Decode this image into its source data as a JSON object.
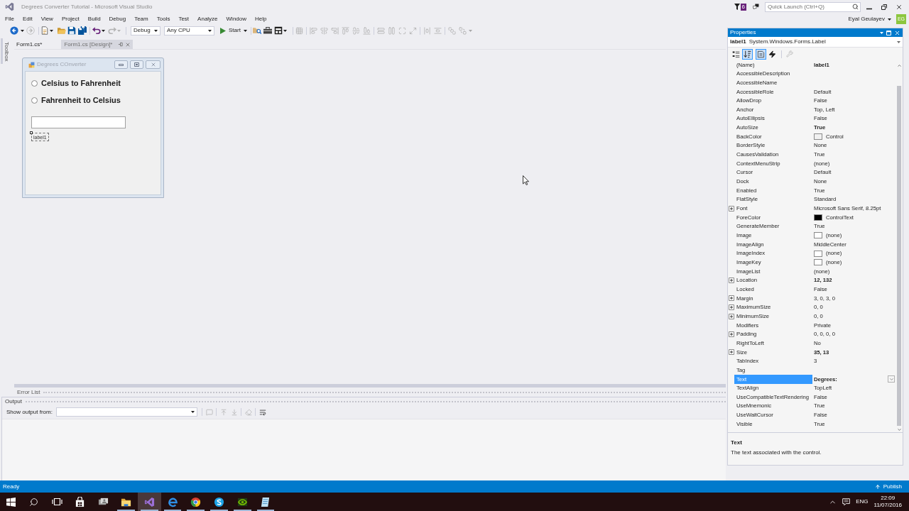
{
  "window": {
    "title": "Degrees Converter Tutorial - Microsoft Visual Studio",
    "notification_count": "6",
    "quick_launch": {
      "placeholder": "Quick Launch (Ctrl+Q)"
    }
  },
  "menu": [
    "File",
    "Edit",
    "View",
    "Project",
    "Build",
    "Debug",
    "Team",
    "Tools",
    "Test",
    "Analyze",
    "Window",
    "Help"
  ],
  "user": {
    "name": "Eyal Geulayev",
    "initials": "EG"
  },
  "toolbar": {
    "forward_disabled": true,
    "redo_disabled": true,
    "configuration": "Debug",
    "platform": "Any CPU",
    "start": "Start",
    "layout_tools_disabled": true
  },
  "toolbox_tab": "Toolbox",
  "document_tabs": [
    {
      "label": "Form1.cs*",
      "selected": false
    },
    {
      "label": "Form1.cs [Design]*",
      "selected": true
    }
  ],
  "form": {
    "title": "Degrees COnverter",
    "radios": [
      {
        "label": "Celsius to Fahrenheit",
        "checked": false
      },
      {
        "label": "Fahrenheit to Celsius",
        "checked": false
      }
    ],
    "label": {
      "text": "label1",
      "selected": true
    }
  },
  "error_list_tab": "Error List",
  "output": {
    "title": "Output",
    "source_label": "Show output from:",
    "tool_buttons": [
      {
        "disabled": true
      },
      {
        "disabled": true
      },
      {
        "disabled": true
      },
      {
        "disabled": true
      },
      {
        "disabled": false
      }
    ]
  },
  "properties": {
    "title": "Properties",
    "object_name": "label1",
    "object_type": "System.Windows.Forms.Label",
    "tool_buttons": [
      {
        "selected": false,
        "disabled": false
      },
      {
        "selected": true,
        "disabled": false
      },
      {
        "selected": true,
        "disabled": false
      },
      {
        "selected": false,
        "disabled": false
      },
      {
        "selected": false,
        "disabled": true
      }
    ],
    "rows": [
      {
        "name": "(Name)",
        "value": "label1",
        "bold": true,
        "selected": false
      },
      {
        "name": "AccessibleDescription",
        "selected": false
      },
      {
        "name": "AccessibleName",
        "selected": false
      },
      {
        "name": "AccessibleRole",
        "value": "Default",
        "bold": false,
        "selected": false
      },
      {
        "name": "AllowDrop",
        "value": "False",
        "bold": false,
        "selected": false
      },
      {
        "name": "Anchor",
        "value": "Top, Left",
        "bold": false,
        "selected": false
      },
      {
        "name": "AutoEllipsis",
        "value": "False",
        "bold": false,
        "selected": false
      },
      {
        "name": "AutoSize",
        "value": "True",
        "bold": true,
        "selected": false
      },
      {
        "name": "BackColor",
        "value": "Control",
        "bold": false,
        "selected": false,
        "color": "#f0f0f0"
      },
      {
        "name": "BorderStyle",
        "value": "None",
        "bold": false,
        "selected": false
      },
      {
        "name": "CausesValidation",
        "value": "True",
        "bold": false,
        "selected": false
      },
      {
        "name": "ContextMenuStrip",
        "value": "(none)",
        "bold": false,
        "selected": false
      },
      {
        "name": "Cursor",
        "value": "Default",
        "bold": false,
        "selected": false
      },
      {
        "name": "Dock",
        "value": "None",
        "bold": false,
        "selected": false
      },
      {
        "name": "Enabled",
        "value": "True",
        "bold": false,
        "selected": false
      },
      {
        "name": "FlatStyle",
        "value": "Standard",
        "bold": false,
        "selected": false
      },
      {
        "name": "Font",
        "value": "Microsoft Sans Serif, 8.25pt",
        "bold": false,
        "selected": false,
        "expanded": false
      },
      {
        "name": "ForeColor",
        "value": "ControlText",
        "bold": false,
        "selected": false,
        "color": "#000000"
      },
      {
        "name": "GenerateMember",
        "value": "True",
        "bold": false,
        "selected": false
      },
      {
        "name": "Image",
        "value": "(none)",
        "bold": false,
        "selected": false,
        "color": "#ffffff"
      },
      {
        "name": "ImageAlign",
        "value": "MiddleCenter",
        "bold": false,
        "selected": false
      },
      {
        "name": "ImageIndex",
        "value": "(none)",
        "bold": false,
        "selected": false,
        "color": "#ffffff"
      },
      {
        "name": "ImageKey",
        "value": "(none)",
        "bold": false,
        "selected": false,
        "color": "#ffffff"
      },
      {
        "name": "ImageList",
        "value": "(none)",
        "bold": false,
        "selected": false
      },
      {
        "name": "Location",
        "value": "12, 132",
        "bold": true,
        "selected": false,
        "expanded": false
      },
      {
        "name": "Locked",
        "value": "False",
        "bold": false,
        "selected": false
      },
      {
        "name": "Margin",
        "value": "3, 0, 3, 0",
        "bold": false,
        "selected": false,
        "expanded": false
      },
      {
        "name": "MaximumSize",
        "value": "0, 0",
        "bold": false,
        "selected": false,
        "expanded": false
      },
      {
        "name": "MinimumSize",
        "value": "0, 0",
        "bold": false,
        "selected": false,
        "expanded": false
      },
      {
        "name": "Modifiers",
        "value": "Private",
        "bold": false,
        "selected": false
      },
      {
        "name": "Padding",
        "value": "0, 0, 0, 0",
        "bold": false,
        "selected": false,
        "expanded": false
      },
      {
        "name": "RightToLeft",
        "value": "No",
        "bold": false,
        "selected": false
      },
      {
        "name": "Size",
        "value": "35, 13",
        "bold": true,
        "selected": false,
        "expanded": false
      },
      {
        "name": "TabIndex",
        "value": "3",
        "bold": false,
        "selected": false
      },
      {
        "name": "Tag",
        "selected": false
      },
      {
        "name": "Text",
        "value": "Degrees:",
        "bold": true,
        "selected": true
      },
      {
        "name": "TextAlign",
        "value": "TopLeft",
        "bold": false,
        "selected": false
      },
      {
        "name": "UseCompatibleTextRendering",
        "value": "False",
        "bold": false,
        "selected": false
      },
      {
        "name": "UseMnemonic",
        "value": "True",
        "bold": false,
        "selected": false
      },
      {
        "name": "UseWaitCursor",
        "value": "False",
        "bold": false,
        "selected": false
      },
      {
        "name": "Visible",
        "value": "True",
        "bold": false,
        "selected": false
      }
    ],
    "description": {
      "title": "Text",
      "text": "The text associated with the control."
    }
  },
  "status_bar": {
    "text": "Ready",
    "publish": "Publish"
  },
  "taskbar": {
    "apps": [
      {
        "running": false,
        "selected": false
      },
      {
        "running": false,
        "selected": false
      },
      {
        "running": true,
        "selected": false
      },
      {
        "running": true,
        "selected": true
      },
      {
        "running": true,
        "selected": false
      },
      {
        "running": true,
        "selected": false
      },
      {
        "running": true,
        "selected": false
      },
      {
        "running": true,
        "selected": false
      },
      {
        "running": true,
        "selected": false
      }
    ],
    "language": "ENG",
    "time": "22:09",
    "date": "11/07/2016"
  }
}
